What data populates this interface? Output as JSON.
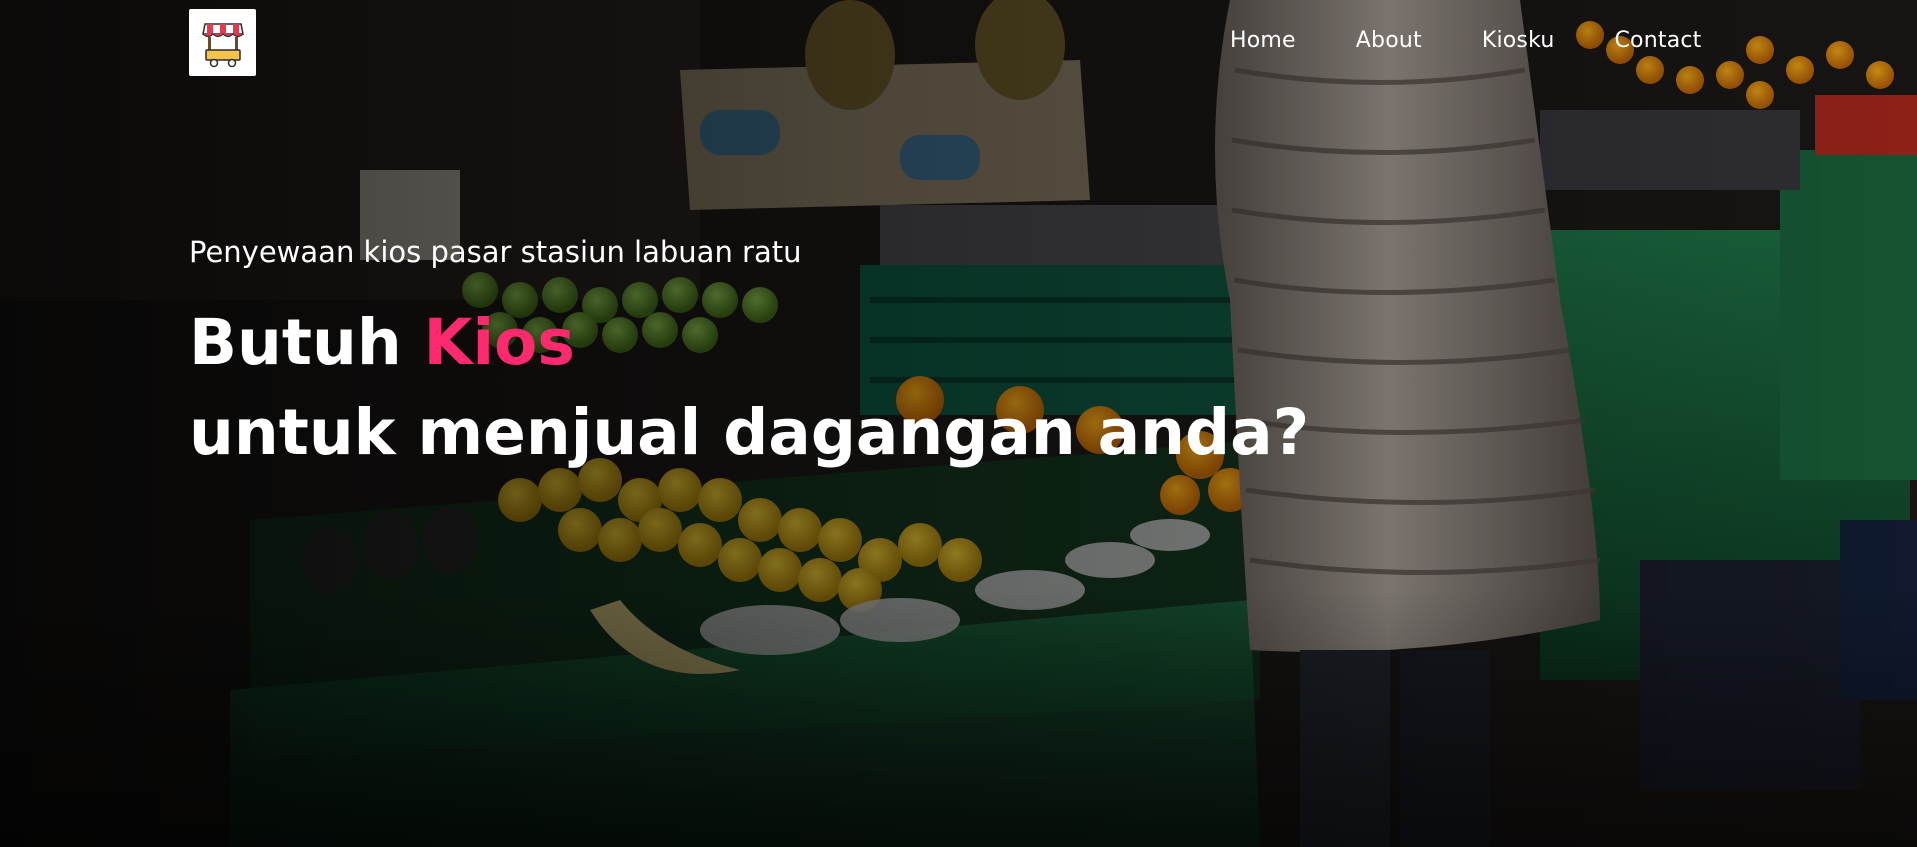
{
  "brand": {
    "logo_icon": "market-stall-cart-icon"
  },
  "nav": {
    "items": [
      {
        "label": "Home"
      },
      {
        "label": "About"
      },
      {
        "label": "Kiosku"
      },
      {
        "label": "Contact"
      }
    ]
  },
  "hero": {
    "subtitle": "Penyewaan kios pasar stasiun labuan ratu",
    "headline_prefix": "Butuh ",
    "headline_accent": "Kios",
    "headline_line2": "untuk menjual dagangan anda?",
    "accent_color": "#ff2a6d",
    "background": "market-fruit-stall-photo"
  }
}
